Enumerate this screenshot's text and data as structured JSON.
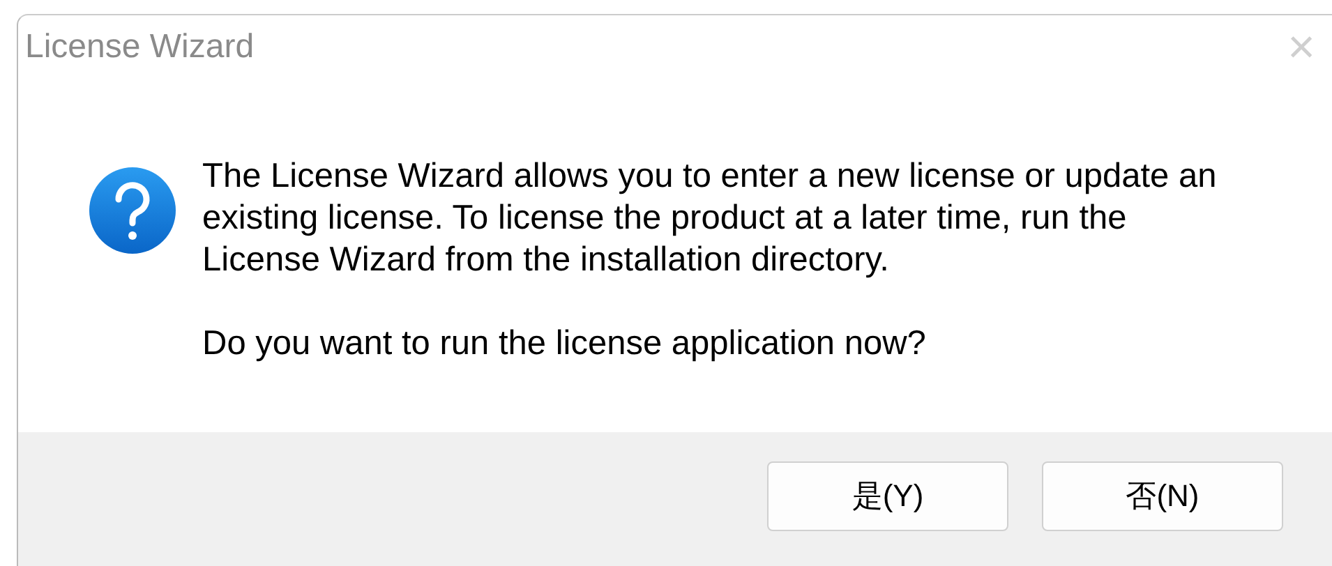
{
  "window": {
    "title": "License Wizard",
    "close": "×"
  },
  "message": {
    "paragraphs": [
      "The License Wizard allows you to enter a new license or update an existing license. To license the product at a later time, run the License Wizard from the installation directory.",
      "Do you want to run the license application now?"
    ]
  },
  "buttons": [
    {
      "label": "是(Y)"
    },
    {
      "label": "否(N)"
    }
  ]
}
